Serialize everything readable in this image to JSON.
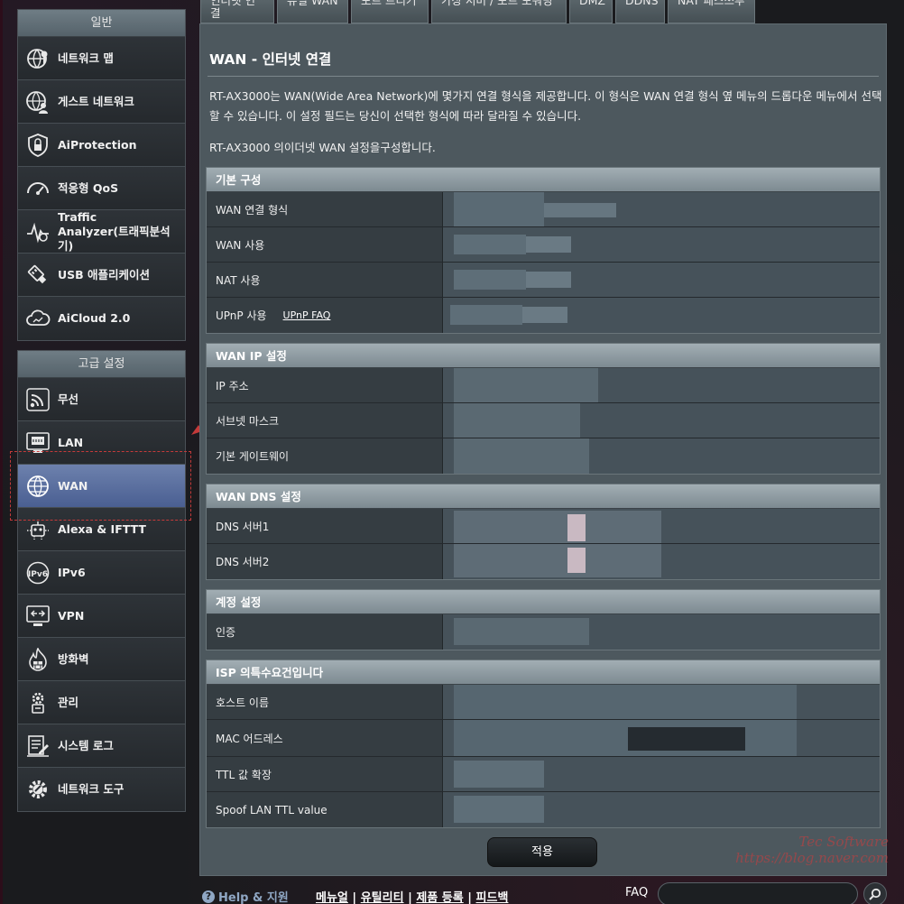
{
  "sidebar": {
    "general_header": "일반",
    "general_items": [
      {
        "label": "네트워크 맵",
        "icon": "network-map-icon"
      },
      {
        "label": "게스트 네트워크",
        "icon": "guest-network-icon"
      },
      {
        "label": "AiProtection",
        "icon": "aiprotection-lock-icon"
      },
      {
        "label": "적응형 QoS",
        "icon": "qos-gauge-icon"
      },
      {
        "label1": "Traffic",
        "label2": "Analyzer(트래픽분석기)",
        "icon": "traffic-analyzer-icon"
      },
      {
        "label": "USB 애플리케이션",
        "icon": "usb-icon"
      },
      {
        "label": "AiCloud 2.0",
        "icon": "aicloud-icon"
      }
    ],
    "advanced_header": "고급 설정",
    "advanced_items": [
      {
        "label": "무선",
        "icon": "wireless-icon"
      },
      {
        "label": "LAN",
        "icon": "lan-icon"
      },
      {
        "label": "WAN",
        "icon": "wan-globe-icon",
        "active": true
      },
      {
        "label": "Alexa & IFTTT",
        "icon": "alexa-ifttt-icon"
      },
      {
        "label": "IPv6",
        "icon": "ipv6-icon"
      },
      {
        "label": "VPN",
        "icon": "vpn-icon"
      },
      {
        "label": "방화벽",
        "icon": "firewall-icon"
      },
      {
        "label": "관리",
        "icon": "administration-icon"
      },
      {
        "label": "시스템 로그",
        "icon": "system-log-icon"
      },
      {
        "label": "네트워크 도구",
        "icon": "network-tools-icon"
      }
    ]
  },
  "tabs": [
    "인터넷 연결",
    "듀얼 WAN",
    "포트 트리거",
    "가상 서버 / 포트 포워딩",
    "DMZ",
    "DDNS",
    "NAT 패스쓰루"
  ],
  "main": {
    "title": "WAN - 인터넷 연결",
    "description1": "RT-AX3000는 WAN(Wide Area Network)에 몇가지 연결 형식을 제공합니다. 이 형식은 WAN 연결 형식 옆 메뉴의 드롭다운 메뉴에서 선택할 수 있습니다. 이 설정 필드는 당신이 선택한 형식에 따라 달라질 수 있습니다.",
    "description2": "RT-AX3000 의이더넷 WAN 설정을구성합니다.",
    "sections": {
      "basic": {
        "header": "기본 구성",
        "rows": [
          "WAN 연결 형식",
          "WAN 사용",
          "NAT 사용",
          "UPnP 사용"
        ],
        "upnp_faq": "UPnP  FAQ"
      },
      "wanip": {
        "header": "WAN IP 설정",
        "rows": [
          "IP 주소",
          "서브넷 마스크",
          "기본 게이트웨이"
        ]
      },
      "dns": {
        "header": "WAN DNS 설정",
        "rows": [
          "DNS 서버1",
          "DNS 서버2"
        ]
      },
      "account": {
        "header": "계정 설정",
        "rows": [
          "인증"
        ]
      },
      "isp": {
        "header": "ISP 의특수요건입니다",
        "rows": [
          "호스트 이름",
          "MAC 어드레스",
          "TTL 값 확장",
          "Spoof LAN TTL value"
        ]
      }
    },
    "apply_label": "적용"
  },
  "footer": {
    "help": "Help & 지원",
    "links": [
      "메뉴얼",
      "유틸리티",
      "제품 등록",
      "피드백"
    ],
    "faq_label": "FAQ",
    "faq_placeholder": ""
  },
  "watermark": {
    "line1": "Tec Software",
    "line2": "https://blog.naver.com"
  },
  "colors": {
    "active_menu": "#5a6fa0",
    "panel": "#4d585e",
    "section_head": "#8f9ba1",
    "highlight_box": "#c43a3a"
  }
}
